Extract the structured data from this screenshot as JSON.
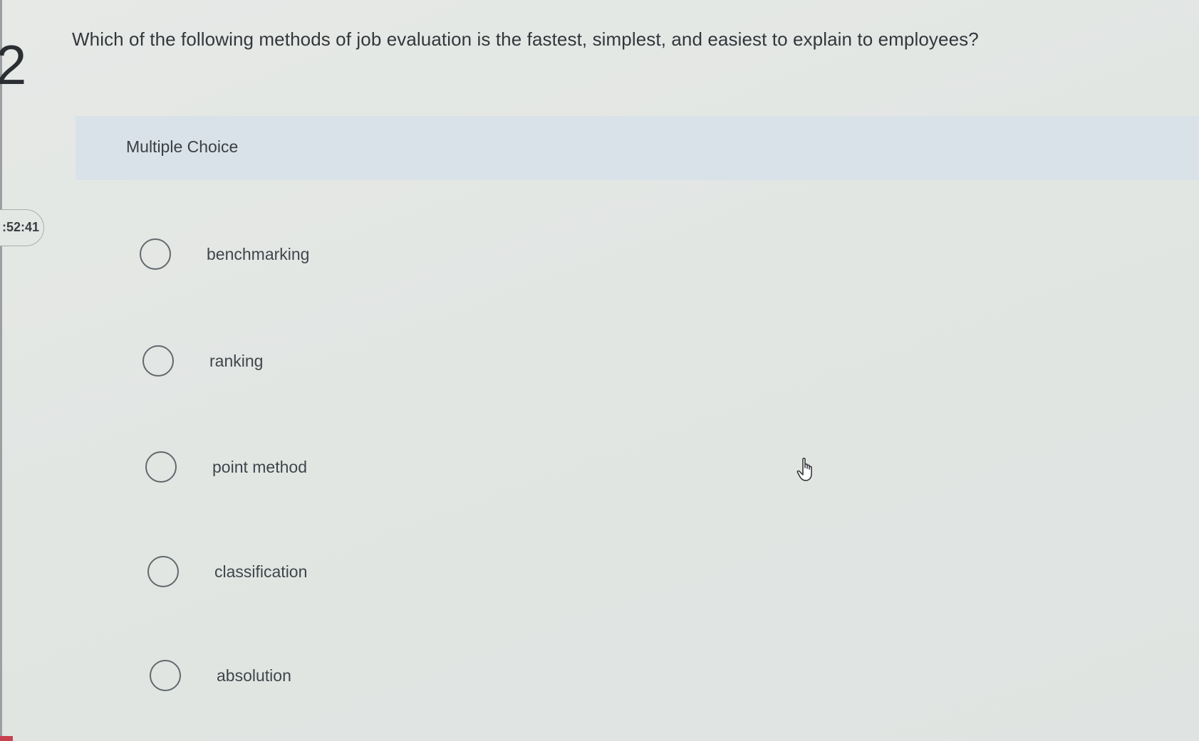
{
  "question": {
    "number": "2",
    "text": "Which of the following methods of job evaluation is the fastest, simplest, and easiest to explain to employees?"
  },
  "section": {
    "label": "Multiple Choice"
  },
  "timer": {
    "text": ":52:41"
  },
  "options": [
    {
      "label": "benchmarking"
    },
    {
      "label": "ranking"
    },
    {
      "label": "point method"
    },
    {
      "label": "classification"
    },
    {
      "label": "absolution"
    }
  ],
  "cursor": {
    "icon": "hand-pointer-icon"
  },
  "colors": {
    "banner": "#d9e2e8",
    "text": "#2f3338",
    "radio_border": "#62686d",
    "accent_mark": "#c8414f"
  }
}
